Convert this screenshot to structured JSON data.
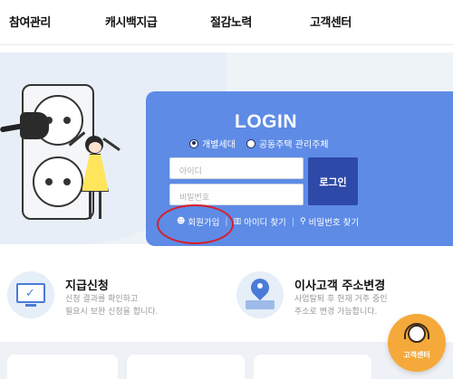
{
  "nav": {
    "items": [
      "참여관리",
      "캐시백지급",
      "절감노력",
      "고객센터"
    ]
  },
  "login": {
    "title": "LOGIN",
    "radio_options": [
      "개별세대",
      "공동주택 관리주체"
    ],
    "selected_radio": "개별세대",
    "id_placeholder": "아이디",
    "pw_placeholder": "비밀번호",
    "login_button": "로그인",
    "links": {
      "signup": "회원가입",
      "find_id": "아이디 찾기",
      "find_pw": "비밀번호 찾기"
    },
    "accent_color": "#5e8be6",
    "button_color": "#2e4aa8",
    "highlight_color": "#d81e2a"
  },
  "services": [
    {
      "title": "지급신청",
      "desc_lines": [
        "신청 결과를 확인하고",
        "필요시 보완 신청을 합니다."
      ],
      "icon": "monitor-check-icon"
    },
    {
      "title": "이사고객 주소변경",
      "desc_lines": [
        "사업탈퇴 후 현재 거주 중인",
        "주소로 변경 가능합니다."
      ],
      "icon": "map-pin-icon"
    }
  ],
  "floating": {
    "label": "고객센터",
    "color": "#f5a93a"
  }
}
